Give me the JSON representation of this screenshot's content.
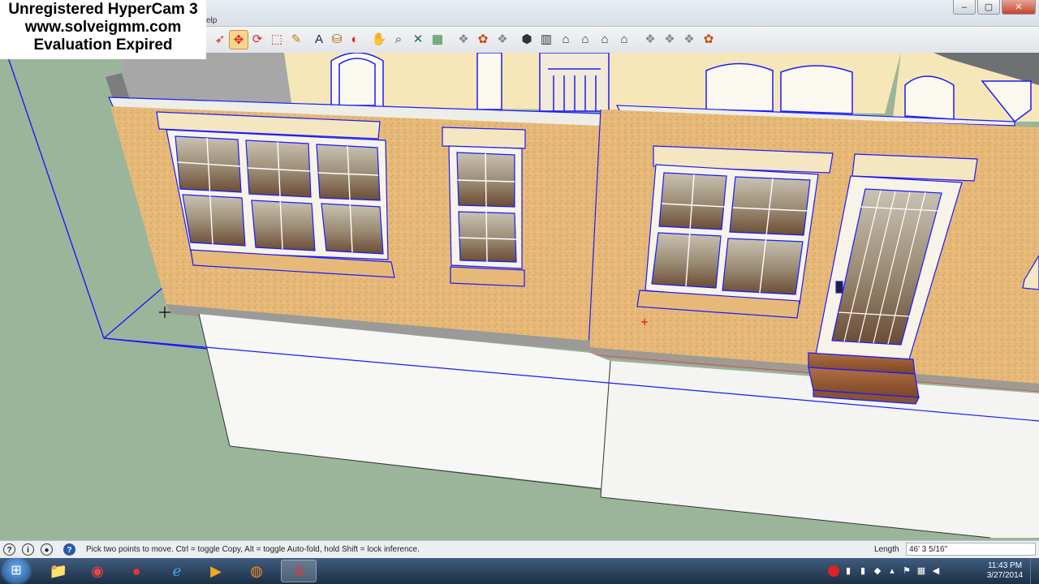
{
  "watermark": {
    "line1": "Unregistered HyperCam 3",
    "line2": "www.solveigmm.com",
    "line3": "Evaluation Expired"
  },
  "menu": {
    "partial_help": "elp"
  },
  "window_controls": {
    "minimize": "–",
    "maximize": "▢",
    "close": "✕"
  },
  "toolbar": {
    "tools": [
      {
        "name": "lasso-select-icon",
        "glyph": "➶",
        "color": "#d22"
      },
      {
        "name": "move-icon",
        "glyph": "✥",
        "color": "#d22",
        "active": true
      },
      {
        "name": "rotate-icon",
        "glyph": "⟳",
        "color": "#d22"
      },
      {
        "name": "scale-icon",
        "glyph": "⬚",
        "color": "#d22"
      },
      {
        "name": "tape-measure-icon",
        "glyph": "✎",
        "color": "#b8860b"
      },
      {
        "name": "text-label-icon",
        "glyph": "A",
        "color": "#224"
      },
      {
        "name": "paint-bucket-icon",
        "glyph": "⛁",
        "color": "#a60"
      },
      {
        "name": "orbit-icon",
        "glyph": "◐",
        "color": "#d22"
      },
      {
        "name": "pan-icon",
        "glyph": "✋",
        "color": "#444"
      },
      {
        "name": "zoom-icon",
        "glyph": "⌕",
        "color": "#246"
      },
      {
        "name": "zoom-extents-icon",
        "glyph": "✕",
        "color": "#264"
      },
      {
        "name": "map-icon",
        "glyph": "▦",
        "color": "#384"
      },
      {
        "name": "model-icon-1",
        "glyph": "❖",
        "color": "#888"
      },
      {
        "name": "components-icon",
        "glyph": "✿",
        "color": "#c40"
      },
      {
        "name": "model-icon-2",
        "glyph": "❖",
        "color": "#888"
      },
      {
        "name": "iso-view-icon",
        "glyph": "⬢",
        "color": "#333"
      },
      {
        "name": "top-view-icon",
        "glyph": "▥",
        "color": "#333"
      },
      {
        "name": "front-view-icon",
        "glyph": "⌂",
        "color": "#333"
      },
      {
        "name": "right-view-icon",
        "glyph": "⌂",
        "color": "#333"
      },
      {
        "name": "back-view-icon",
        "glyph": "⌂",
        "color": "#333"
      },
      {
        "name": "left-view-icon",
        "glyph": "⌂",
        "color": "#333"
      },
      {
        "name": "warehouse-icon",
        "glyph": "❖",
        "color": "#888"
      },
      {
        "name": "share-model-icon",
        "glyph": "❖",
        "color": "#888"
      },
      {
        "name": "share-component-icon",
        "glyph": "❖",
        "color": "#888"
      },
      {
        "name": "extension-icon",
        "glyph": "✿",
        "color": "#c40"
      }
    ]
  },
  "status": {
    "instruction": "Pick two points to move.  Ctrl = toggle Copy, Alt = toggle Auto-fold, hold Shift = lock inference.",
    "length_label": "Length",
    "length_value": "46' 3 5/16\"",
    "icons": [
      "geo-location-icon",
      "credits-icon",
      "user-icon",
      "help-icon"
    ]
  },
  "taskbar": {
    "start_glyph": "⊞",
    "apps": [
      {
        "name": "explorer-task",
        "glyph": "📁"
      },
      {
        "name": "chrome-task",
        "glyph": "◉"
      },
      {
        "name": "recorder-task",
        "glyph": "●"
      },
      {
        "name": "ie-task",
        "glyph": "ℯ"
      },
      {
        "name": "media-player-task",
        "glyph": "▶"
      },
      {
        "name": "firefox-task",
        "glyph": "◍"
      },
      {
        "name": "sketchup-task",
        "glyph": "S",
        "active": true
      }
    ],
    "time": "11:43 PM",
    "date": "3/27/2014"
  },
  "colors": {
    "ground": "#9bb59b",
    "stucco": "#e7b978",
    "wall_light": "#f6e7b8",
    "selection": "#1a1aff",
    "trim": "#f3e6c1",
    "foundation": "#f7f7f5"
  }
}
